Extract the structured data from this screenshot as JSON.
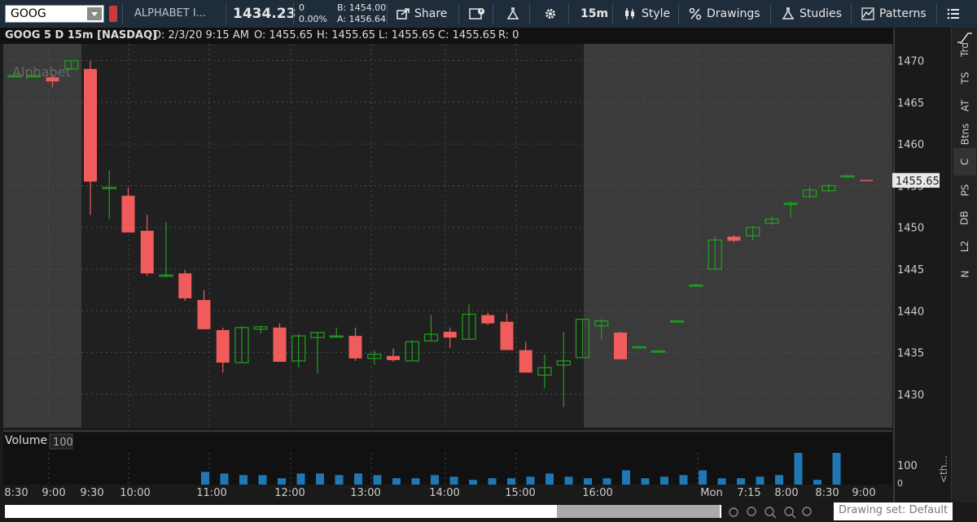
{
  "toolbar": {
    "symbol": "GOOG",
    "company": "ALPHABET I...",
    "last_price": "1434.23",
    "net_change": "0",
    "pct_change": "0.00%",
    "bid": "B: 1454.00",
    "ask": "A: 1456.64",
    "share_label": "Share",
    "interval_label": "15m",
    "style_label": "Style",
    "drawings_label": "Drawings",
    "studies_label": "Studies",
    "patterns_label": "Patterns"
  },
  "infobar": {
    "title": "GOOG 5 D 15m [NASDAQ]",
    "date": "D: 2/3/20 9:15 AM",
    "open": "O: 1455.65",
    "high": "H: 1455.65",
    "low": "L: 1455.65",
    "close": "C: 1455.65",
    "range": "R: 0"
  },
  "right_tabs": [
    "Trd",
    "TS",
    "AT",
    "Btns",
    "C",
    "PS",
    "DB",
    "L2",
    "N"
  ],
  "selected_tab": "C",
  "volume_panel": {
    "title": "Volume",
    "value": "100",
    "scale_label": "100",
    "scale_label_low": "0",
    "side_label": "<th..."
  },
  "bottom": {
    "drawing_set": "Drawing set: Default"
  },
  "colors": {
    "up": "#1fa31f",
    "down": "#f05b5b",
    "volume": "#1f77b4",
    "session_bg": "#202020",
    "extended_bg": "#3b3b3b",
    "price_tag_bg": "#e8e8e8"
  },
  "chart_data": {
    "type": "candlestick",
    "title": "GOOG 5 D 15m [NASDAQ]",
    "watermark": "Alphabet",
    "ylim": [
      1426,
      1472
    ],
    "y_ticks": [
      1430,
      1435,
      1440,
      1445,
      1450,
      1455,
      1460,
      1465,
      1470
    ],
    "last_price_label": "1455.65",
    "x_tick_labels": [
      "8:30",
      "9:00",
      "9:30",
      "10:00",
      "11:00",
      "12:00",
      "13:00",
      "14:00",
      "15:00",
      "16:00",
      "Mon",
      "7:15",
      "8:00",
      "8:30",
      "9:00"
    ],
    "candles": [
      {
        "o": 1468.2,
        "h": 1468.2,
        "l": 1468.2,
        "c": 1468.2
      },
      {
        "o": 1468.2,
        "h": 1468.2,
        "l": 1468.2,
        "c": 1468.2
      },
      {
        "o": 1468.0,
        "h": 1468.2,
        "l": 1466.8,
        "c": 1467.5
      },
      {
        "o": 1469.0,
        "h": 1470.0,
        "l": 1469.0,
        "c": 1470.0
      },
      {
        "o": 1469.0,
        "h": 1470.0,
        "l": 1451.5,
        "c": 1455.5
      },
      {
        "o": 1454.8,
        "h": 1456.8,
        "l": 1451.0,
        "c": 1454.8
      },
      {
        "o": 1453.8,
        "h": 1454.8,
        "l": 1449.4,
        "c": 1449.4
      },
      {
        "o": 1449.6,
        "h": 1451.5,
        "l": 1444.2,
        "c": 1444.5
      },
      {
        "o": 1444.2,
        "h": 1450.6,
        "l": 1444.0,
        "c": 1444.3
      },
      {
        "o": 1444.5,
        "h": 1444.9,
        "l": 1441.2,
        "c": 1441.5
      },
      {
        "o": 1441.3,
        "h": 1442.5,
        "l": 1437.8,
        "c": 1437.8
      },
      {
        "o": 1437.7,
        "h": 1438.0,
        "l": 1432.6,
        "c": 1433.8
      },
      {
        "o": 1433.8,
        "h": 1438.2,
        "l": 1433.8,
        "c": 1438.0
      },
      {
        "o": 1437.8,
        "h": 1438.2,
        "l": 1437.3,
        "c": 1438.1
      },
      {
        "o": 1438.0,
        "h": 1438.5,
        "l": 1433.9,
        "c": 1433.9
      },
      {
        "o": 1434.0,
        "h": 1437.2,
        "l": 1433.2,
        "c": 1437.0
      },
      {
        "o": 1436.8,
        "h": 1437.4,
        "l": 1432.5,
        "c": 1437.4
      },
      {
        "o": 1436.9,
        "h": 1438.0,
        "l": 1436.8,
        "c": 1437.0
      },
      {
        "o": 1437.0,
        "h": 1438.0,
        "l": 1434.0,
        "c": 1434.3
      },
      {
        "o": 1434.3,
        "h": 1435.3,
        "l": 1433.5,
        "c": 1434.8
      },
      {
        "o": 1434.6,
        "h": 1435.5,
        "l": 1433.9,
        "c": 1434.1
      },
      {
        "o": 1434.0,
        "h": 1436.5,
        "l": 1434.0,
        "c": 1436.3
      },
      {
        "o": 1436.4,
        "h": 1439.5,
        "l": 1436.4,
        "c": 1437.2
      },
      {
        "o": 1437.5,
        "h": 1438.0,
        "l": 1435.6,
        "c": 1436.8
      },
      {
        "o": 1436.6,
        "h": 1440.8,
        "l": 1436.6,
        "c": 1439.6
      },
      {
        "o": 1439.5,
        "h": 1439.8,
        "l": 1438.3,
        "c": 1438.5
      },
      {
        "o": 1438.7,
        "h": 1439.7,
        "l": 1435.3,
        "c": 1435.3
      },
      {
        "o": 1435.3,
        "h": 1436.3,
        "l": 1432.6,
        "c": 1432.6
      },
      {
        "o": 1432.3,
        "h": 1434.8,
        "l": 1430.7,
        "c": 1433.2
      },
      {
        "o": 1433.5,
        "h": 1437.5,
        "l": 1428.5,
        "c": 1434.0
      },
      {
        "o": 1434.4,
        "h": 1439.0,
        "l": 1434.4,
        "c": 1439.0
      },
      {
        "o": 1438.2,
        "h": 1439.0,
        "l": 1436.5,
        "c": 1438.8
      },
      {
        "o": 1437.4,
        "h": 1437.5,
        "l": 1434.2,
        "c": 1434.2
      },
      {
        "o": 1435.6,
        "h": 1435.8,
        "l": 1435.5,
        "c": 1435.7
      },
      {
        "o": 1435.2,
        "h": 1435.3,
        "l": 1435.1,
        "c": 1435.2
      },
      {
        "o": 1438.8,
        "h": 1438.9,
        "l": 1438.7,
        "c": 1438.8
      },
      {
        "o": 1443.1,
        "h": 1443.2,
        "l": 1443.0,
        "c": 1443.1
      },
      {
        "o": 1445.0,
        "h": 1449.0,
        "l": 1445.0,
        "c": 1448.5
      },
      {
        "o": 1448.9,
        "h": 1449.1,
        "l": 1448.2,
        "c": 1448.4
      },
      {
        "o": 1449.0,
        "h": 1450.2,
        "l": 1448.5,
        "c": 1450.0
      },
      {
        "o": 1450.5,
        "h": 1451.3,
        "l": 1450.3,
        "c": 1451.0
      },
      {
        "o": 1452.8,
        "h": 1453.1,
        "l": 1451.2,
        "c": 1452.9
      },
      {
        "o": 1453.7,
        "h": 1454.8,
        "l": 1453.5,
        "c": 1454.5
      },
      {
        "o": 1454.4,
        "h": 1455.2,
        "l": 1454.3,
        "c": 1455.0
      },
      {
        "o": 1456.2,
        "h": 1456.3,
        "l": 1456.1,
        "c": 1456.2
      },
      {
        "o": 1455.7,
        "h": 1455.7,
        "l": 1455.6,
        "c": 1455.6
      }
    ],
    "volume": [
      0,
      0,
      0,
      0,
      0,
      0,
      0.4,
      0.35,
      0.3,
      0.3,
      0.2,
      0.35,
      0.35,
      0.3,
      0.35,
      0.3,
      0.2,
      0.2,
      0.3,
      0.25,
      0.15,
      0.2,
      0.2,
      0.25,
      0.35,
      0.25,
      0.2,
      0.2,
      0.45,
      0.2,
      0.25,
      0.3,
      0.45,
      0.2,
      0.2,
      0.25,
      0.3,
      1.0,
      0.15,
      1.0,
      0,
      0,
      0,
      0,
      0,
      0,
      0,
      0,
      0,
      0
    ]
  }
}
